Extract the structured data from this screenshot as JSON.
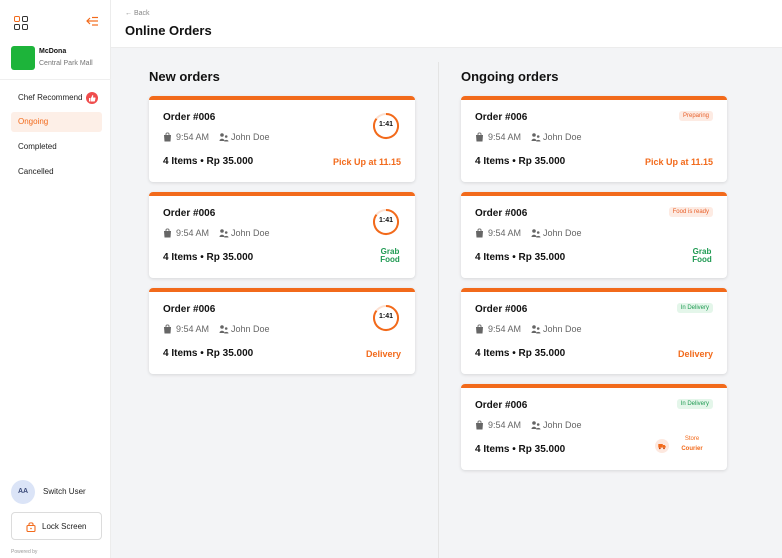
{
  "sidebar": {
    "store_name": "McDona",
    "store_location": "Central Park Mall",
    "nav": [
      {
        "label": "Chef Recommend",
        "active": false,
        "badge": true
      },
      {
        "label": "Ongoing",
        "active": true
      },
      {
        "label": "Completed",
        "active": false
      },
      {
        "label": "Cancelled",
        "active": false
      }
    ],
    "avatar_initials": "AA",
    "switch_user": "Switch User",
    "lock_screen": "Lock Screen",
    "powered_by": "Powered by"
  },
  "header": {
    "back": "← Back",
    "title": "Online Orders"
  },
  "new_orders": {
    "title": "New orders",
    "cards": [
      {
        "order_id": "Order #006",
        "time": "9:54 AM",
        "customer": "John Doe",
        "summary": "4 Items • Rp 35.000",
        "timer": "1:41",
        "method": "Pick Up at 11.15"
      },
      {
        "order_id": "Order #006",
        "time": "9:54 AM",
        "customer": "John Doe",
        "summary": "4 Items • Rp 35.000",
        "timer": "1:41",
        "method_logo_line1": "Grab",
        "method_logo_line2": "Food"
      },
      {
        "order_id": "Order #006",
        "time": "9:54 AM",
        "customer": "John Doe",
        "summary": "4 Items • Rp 35.000",
        "timer": "1:41",
        "method": "Delivery"
      }
    ]
  },
  "ongoing_orders": {
    "title": "Ongoing orders",
    "cards": [
      {
        "order_id": "Order #006",
        "time": "9:54 AM",
        "customer": "John Doe",
        "summary": "4 Items • Rp 35.000",
        "status": "Preparing",
        "method": "Pick Up at 11.15"
      },
      {
        "order_id": "Order #006",
        "time": "9:54 AM",
        "customer": "John Doe",
        "summary": "4 Items • Rp 35.000",
        "status": "Food is ready",
        "method_logo_line1": "Grab",
        "method_logo_line2": "Food"
      },
      {
        "order_id": "Order #006",
        "time": "9:54 AM",
        "customer": "John Doe",
        "summary": "4 Items • Rp 35.000",
        "status": "In Delivery",
        "method": "Delivery"
      },
      {
        "order_id": "Order #006",
        "time": "9:54 AM",
        "customer": "John Doe",
        "summary": "4 Items • Rp 35.000",
        "status": "In Delivery",
        "method_line1": "Store",
        "method_line2": "Courier"
      }
    ]
  },
  "colors": {
    "accent": "#f26a1b",
    "status_orange_bg": "#fdebe3",
    "status_green_bg": "#e4f6ea",
    "status_green_text": "#1f9a52",
    "store_logo": "#1db43a"
  },
  "icons": [
    "grid-icon",
    "collapse-menu-icon",
    "thumbs-up-icon",
    "lock-icon",
    "bag-icon",
    "person-icon",
    "timer-icon",
    "grabfood-logo",
    "courier-truck-icon"
  ]
}
